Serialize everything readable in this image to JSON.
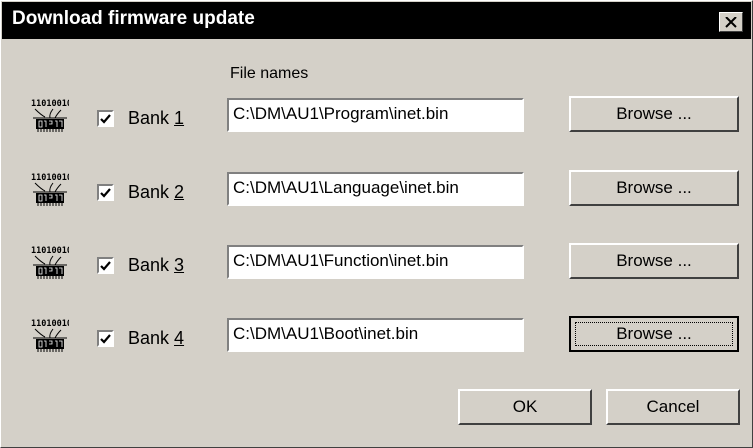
{
  "window": {
    "title": "Download firmware update"
  },
  "columns": {
    "file_names_label": "File names"
  },
  "banks": [
    {
      "label_prefix": "Bank ",
      "number": "1",
      "checked": true,
      "file_path": "C:\\DM\\AU1\\Program\\inet.bin",
      "browse_label": "Browse ...",
      "focused": false
    },
    {
      "label_prefix": "Bank ",
      "number": "2",
      "checked": true,
      "file_path": "C:\\DM\\AU1\\Language\\inet.bin",
      "browse_label": "Browse ...",
      "focused": false
    },
    {
      "label_prefix": "Bank ",
      "number": "3",
      "checked": true,
      "file_path": "C:\\DM\\AU1\\Function\\inet.bin",
      "browse_label": "Browse ...",
      "focused": false
    },
    {
      "label_prefix": "Bank ",
      "number": "4",
      "checked": true,
      "file_path": "C:\\DM\\AU1\\Boot\\inet.bin",
      "browse_label": "Browse ...",
      "focused": true
    }
  ],
  "chip_icon_text": "11010010",
  "buttons": {
    "ok_label": "OK",
    "cancel_label": "Cancel"
  },
  "icons": {
    "close": "close-icon",
    "chip": "firmware-chip-icon",
    "check": "checkmark-icon"
  }
}
